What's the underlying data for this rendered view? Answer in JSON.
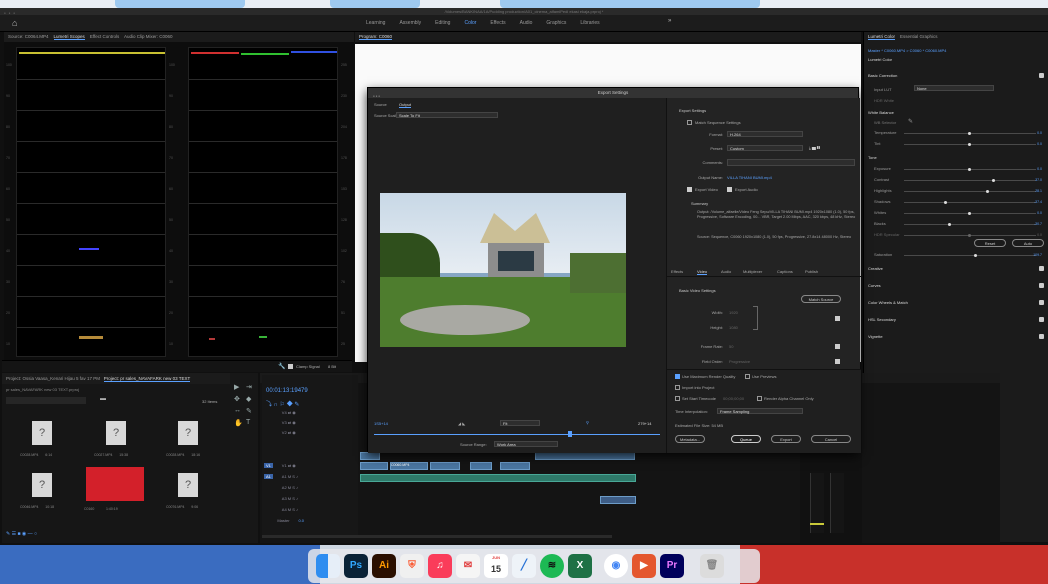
{
  "os": {
    "window_title": "/Volumes/BANKINAA/1A/Pudding production/A01_cinema_alfamiPedi ekasi ekaja.prproj *"
  },
  "workspaces": {
    "tabs": [
      "Learning",
      "Assembly",
      "Editing",
      "Color",
      "Effects",
      "Audio",
      "Graphics",
      "Libraries"
    ],
    "active": "Color"
  },
  "scopes_panel": {
    "tabs": [
      "Source: C0064.MP4",
      "Lumetri Scopes",
      "Effect Controls",
      "Audio Clip Mixer: C0060"
    ],
    "axis_left": [
      "100",
      "90",
      "80",
      "70",
      "60",
      "50",
      "40",
      "30",
      "20",
      "10",
      "0"
    ],
    "mid_labels": [
      "100",
      "90",
      "80",
      "70",
      "60",
      "50",
      "40",
      "30",
      "20",
      "10",
      "0"
    ],
    "right_labels": [
      "255",
      "230",
      "204",
      "178",
      "153",
      "128",
      "102",
      "76",
      "51",
      "25",
      "0"
    ],
    "clamp_label": "Clamp Signal",
    "bit_label": "8 Bit"
  },
  "program": {
    "title": "Program: C0060"
  },
  "export": {
    "title": "Export Settings",
    "source_tab": "Source",
    "output_tab": "Output",
    "source_scaling_label": "Source Scaling:",
    "source_scaling_value": "Scale To Fit",
    "export_settings_head": "Export Settings",
    "match_sequence": "Match Sequence Settings",
    "format_label": "Format:",
    "format_value": "H.264",
    "preset_label": "Preset:",
    "preset_value": "Custom",
    "comments_label": "Comments:",
    "output_name_label": "Output Name:",
    "output_name_value": "VILLA TIHANI BUMI.mp4",
    "export_video": "Export Video",
    "export_audio": "Export Audio",
    "summary_head": "Summary",
    "summary_output": "Output: /Volume_alfaelle/Video Feng Sepu/VILLA TIHANI BUMI.mp4 1920x1080 (1.0), 50 fps, Progressive, Software Encoding, 00... VBR, Target 2.00 Mbps, AAC, 320 kbps, 48 kHz, Stereo",
    "summary_source": "Source: Sequence, C0060 1920x1080 (1.0), 50 fps, Progressive, 27.8x14 48000 Hz, Stereo",
    "tabs": [
      "Effects",
      "Video",
      "Audio",
      "Multiplexer",
      "Captions",
      "Publish"
    ],
    "basic_video": "Basic Video Settings",
    "match_source": "Match Source",
    "width_label": "Width:",
    "width_value": "1920",
    "height_label": "Height:",
    "height_value": "1080",
    "frame_rate_label": "Frame Rate:",
    "frame_rate_value": "50",
    "field_order_label": "Field Order:",
    "field_order_value": "Progressive",
    "max_render": "Use Maximum Render Quality",
    "use_previews": "Use Previews",
    "import_project": "Import into Project",
    "set_start": "Set Start Timecode",
    "start_tc": "00;00;00;00",
    "render_alpha": "Render Alpha Channel Only",
    "time_interp_label": "Time Interpolation:",
    "time_interp_value": "Frame Sampling",
    "file_size": "Estimated File Size: 54 MB",
    "metadata_btn": "Metadata...",
    "queue_btn": "Queue",
    "export_btn": "Export",
    "cancel_btn": "Cancel",
    "tc_in": "1S5+14",
    "tc_out": "279+14",
    "fit_value": "Fit",
    "source_range_label": "Source Range:",
    "source_range_value": "Work Area"
  },
  "lumetri": {
    "tabs": [
      "Lumetri Color",
      "Essential Graphics"
    ],
    "master_path": "Master * C0060.MP4 > C0060 * C0060.MP4",
    "effect_name": "Lumetri Color",
    "basic_correction": "Basic Correction",
    "input_lut_label": "Input LUT",
    "input_lut_value": "None",
    "hdr_label": "HDR White",
    "white_balance": "White Balance",
    "wb_selector": "WB Selector",
    "temperature": "Temperature",
    "temperature_val": "0.0",
    "tint": "Tint",
    "tint_val": "0.0",
    "tone": "Tone",
    "exposure": "Exposure",
    "exposure_val": "0.0",
    "contrast": "Contrast",
    "contrast_val": "37.0",
    "highlights": "Highlights",
    "highlights_val": "28.1",
    "shadows": "Shadows",
    "shadows_val": "-37.4",
    "whites": "Whites",
    "whites_val": "0.0",
    "blacks": "Blacks",
    "blacks_val": "-30.7",
    "hdr_specular": "HDR Specular",
    "hdr_specular_val": "0.0",
    "reset_btn": "Reset",
    "auto_btn": "Auto",
    "saturation": "Saturation",
    "saturation_val": "109.7",
    "sections": [
      "Creative",
      "Curves",
      "Color Wheels & Match",
      "HSL Secondary",
      "Vignette"
    ]
  },
  "project": {
    "tabs": [
      "Project: Ossia Vaasa_Kenari Hijau 5 fav 17 PM",
      "Project: pr sales_NAVAFARK new 03 TEXT"
    ],
    "path": "pr sales_NAVAFARK new 03 TEXT.prproj",
    "count": "32 Items",
    "items": [
      {
        "name": "C0028.MP4",
        "dur": "6:14"
      },
      {
        "name": "C0027.MP4",
        "dur": "15:38"
      },
      {
        "name": "C0028.MP4",
        "dur": "18:16"
      },
      {
        "name": "C0046.MP4",
        "dur": "10:18"
      },
      {
        "name": "C0160",
        "dur": "1:40:19"
      },
      {
        "name": "C0076.MP4",
        "dur": "9:06"
      }
    ]
  },
  "timeline": {
    "tab1": "jalousie mall",
    "tab2": "jalousie mall 03",
    "timecode": "00:01:13:19479",
    "tracks": [
      "V4",
      "V3",
      "V2",
      "V1",
      "A1",
      "A2",
      "A3",
      "A4"
    ],
    "master": "Master",
    "master_val": "0.0",
    "clip_label": "C0060.MP4"
  },
  "dock": {
    "apps": [
      "Finder",
      "Ps",
      "Ai",
      "Brave",
      "Music",
      "Scrapbox",
      "15",
      "Pages",
      "Spotify",
      "Excel",
      "Chrome",
      "Keynote",
      "Pr",
      "Trash"
    ],
    "calendar_day": "15",
    "calendar_month": "JUN"
  }
}
